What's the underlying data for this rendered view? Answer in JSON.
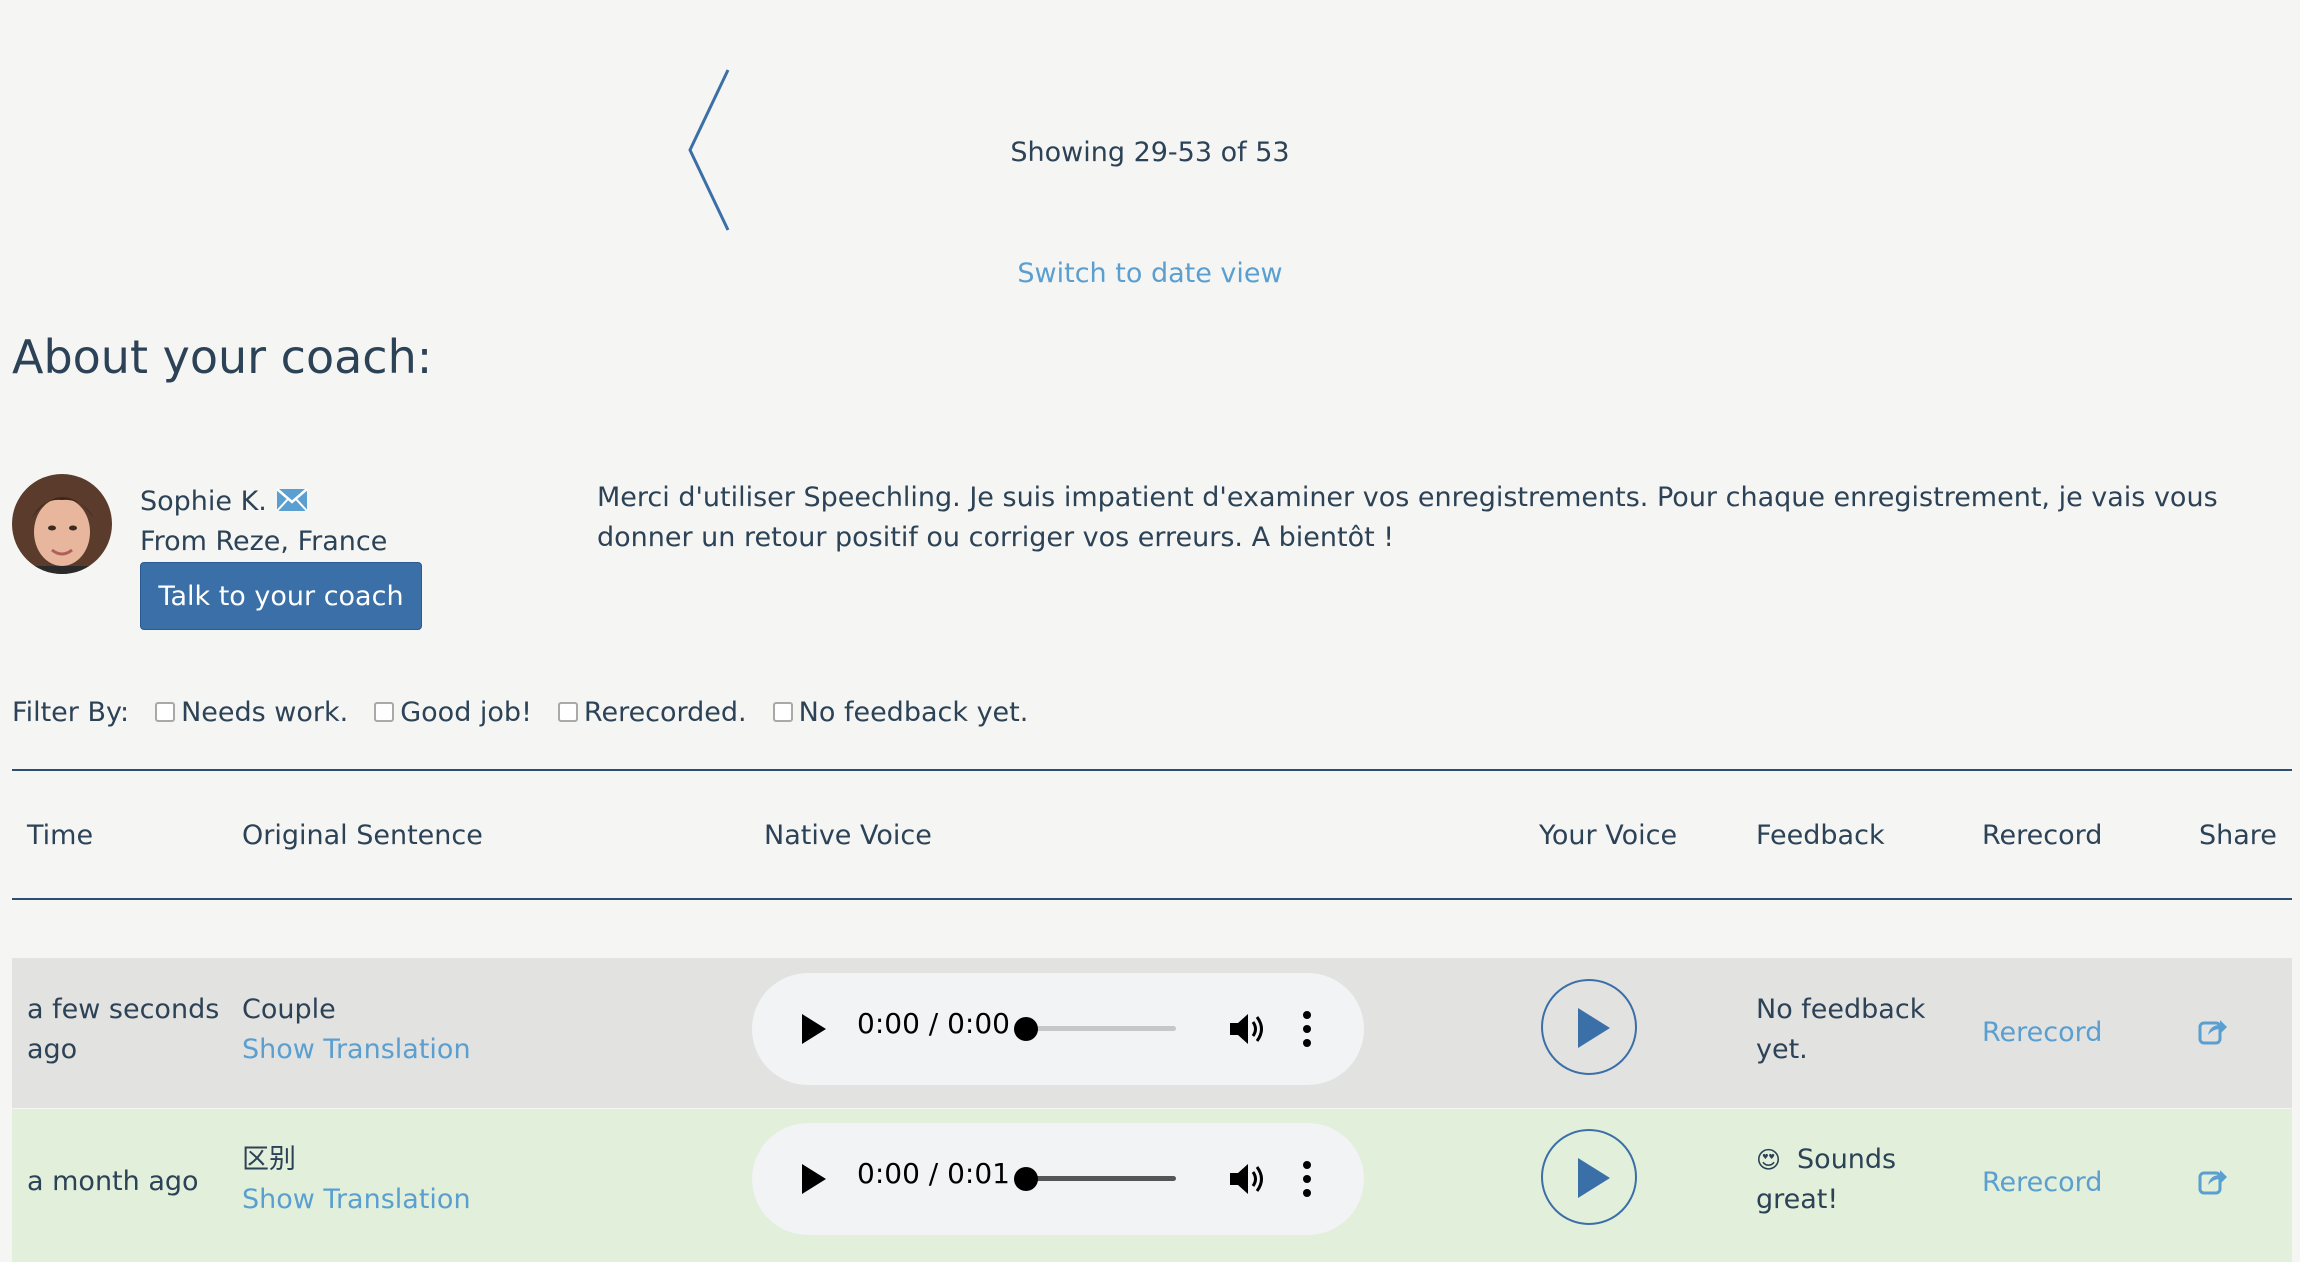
{
  "pager": {
    "status": "Showing 29-53 of 53",
    "switch_view": "Switch to date view"
  },
  "coach": {
    "heading": "About your coach:",
    "name": "Sophie K.",
    "origin": "From Reze, France",
    "talk_button": "Talk to your coach",
    "message": "Merci d'utiliser Speechling. Je suis impatient d'examiner vos enregistrements. Pour chaque enregistrement, je vais vous donner un retour positif ou corriger vos erreurs. A bientôt !"
  },
  "filter": {
    "label": "Filter By:",
    "options": [
      "Needs work.",
      "Good job!",
      "Rerecorded.",
      "No feedback yet."
    ]
  },
  "table": {
    "headers": [
      "Time",
      "Original Sentence",
      "Native Voice",
      "Your Voice",
      "Feedback",
      "Rerecord",
      "Share"
    ],
    "rows": [
      {
        "time": "a few seconds ago",
        "sentence": "Couple",
        "translation_link": "Show Translation",
        "native_time": "0:00 / 0:00",
        "progress": 0,
        "feedback": "No feedback yet.",
        "feedback_emoji": "",
        "rerecord": "Rerecord"
      },
      {
        "time": "a month ago",
        "sentence": "区别",
        "translation_link": "Show Translation",
        "native_time": "0:00 / 0:01",
        "progress": 0,
        "feedback": "Sounds great!",
        "feedback_emoji": "😍",
        "rerecord": "Rerecord"
      }
    ]
  },
  "colors": {
    "accent": "#3b6fa8",
    "link": "#5a9fd0",
    "text": "#2c4256",
    "row_pending": "#e2e2e0",
    "row_good": "#e2efdb"
  },
  "icons": {
    "pager_prev": "chevron-left-icon",
    "mail": "envelope-icon",
    "play": "play-icon",
    "volume": "volume-icon",
    "menu": "more-vertical-icon",
    "share": "share-icon"
  }
}
